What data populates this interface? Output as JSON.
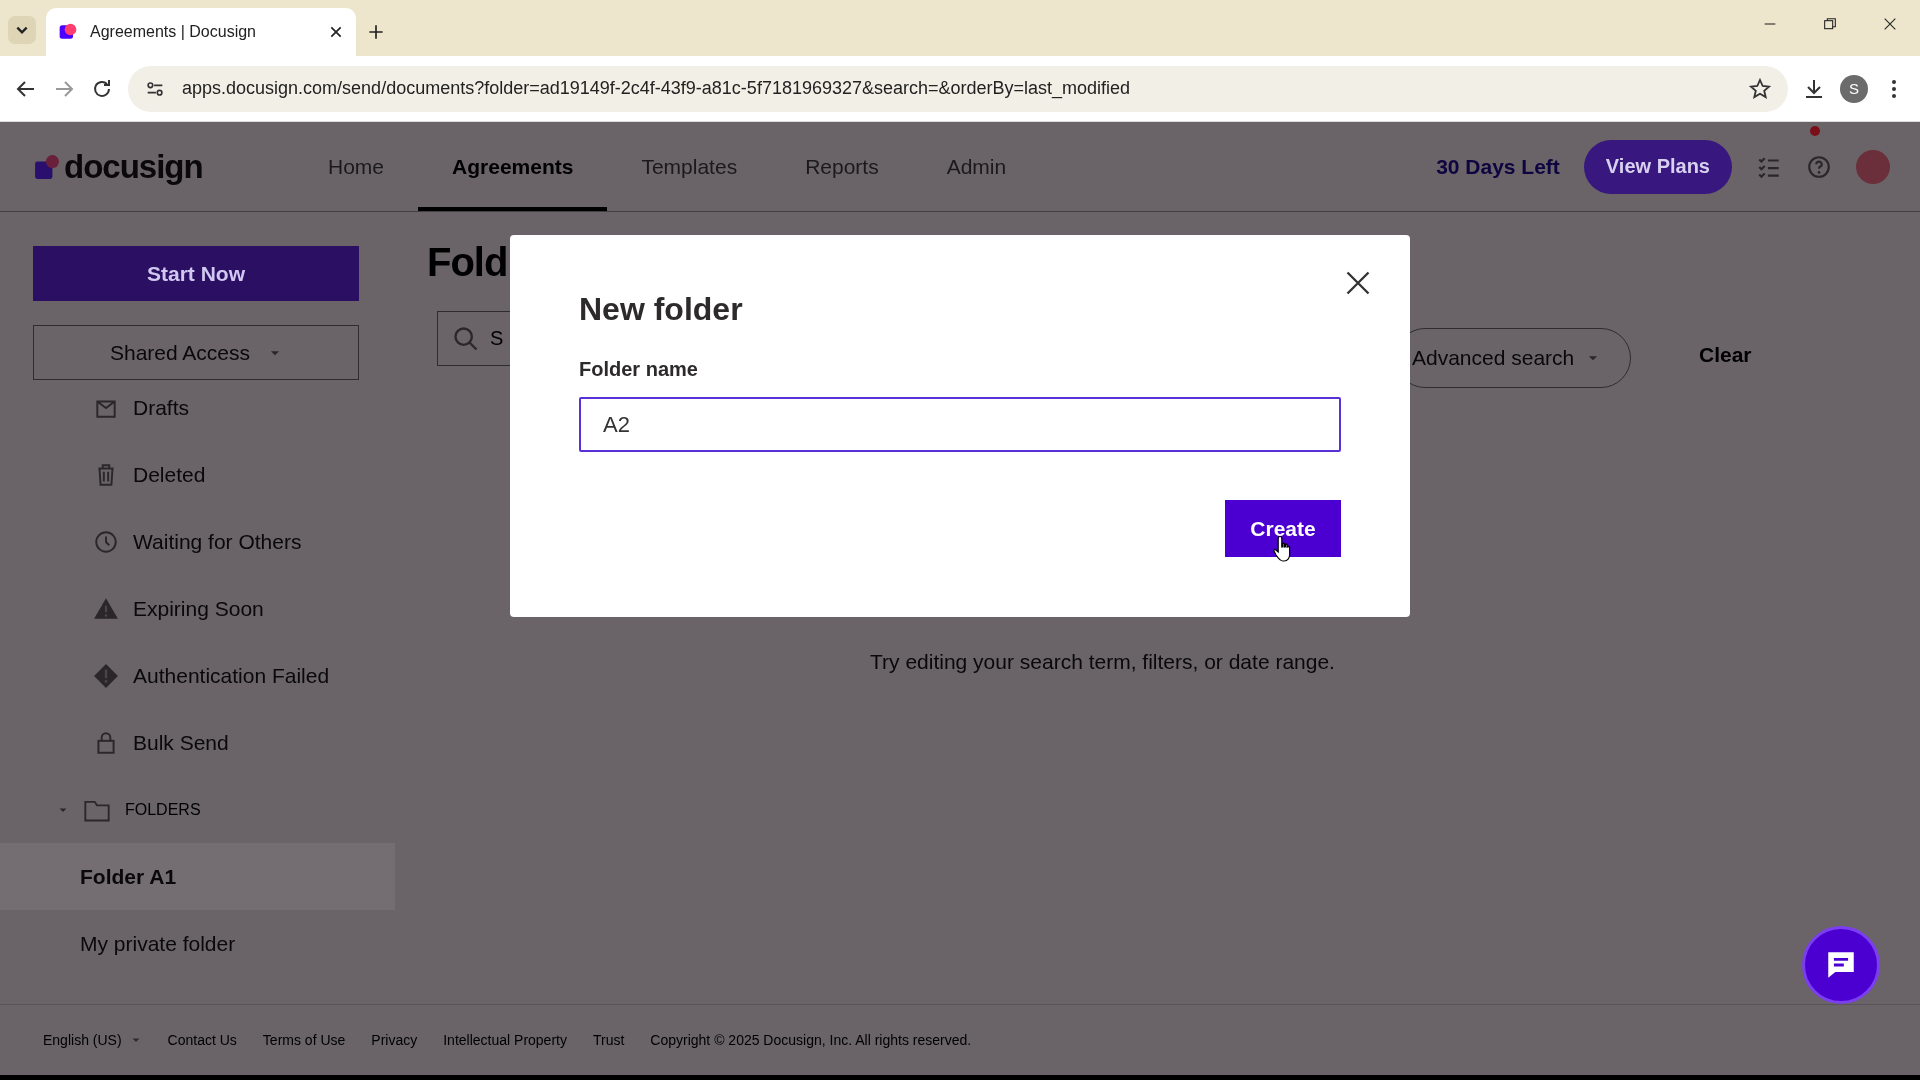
{
  "browser": {
    "tab_title": "Agreements | Docusign",
    "url": "apps.docusign.com/send/documents?folder=ad19149f-2c4f-43f9-a81c-5f7181969327&search=&orderBy=last_modified",
    "profile_initial": "S"
  },
  "header": {
    "logo": "docusign",
    "nav": [
      {
        "label": "Home",
        "selected": false
      },
      {
        "label": "Agreements",
        "selected": true
      },
      {
        "label": "Templates",
        "selected": false
      },
      {
        "label": "Reports",
        "selected": false
      },
      {
        "label": "Admin",
        "selected": false
      }
    ],
    "trial": "30 Days Left",
    "plans_button": "View Plans",
    "notification": true
  },
  "sidebar": {
    "start_button": "Start Now",
    "shared_access": "Shared Access",
    "items": [
      {
        "label": "Drafts"
      },
      {
        "label": "Deleted"
      },
      {
        "label": "Waiting for Others"
      },
      {
        "label": "Expiring Soon"
      },
      {
        "label": "Authentication Failed"
      },
      {
        "label": "Bulk Send"
      }
    ],
    "folders": {
      "label": "FOLDERS",
      "expanded": true,
      "children": [
        {
          "label": "Folder A1",
          "selected": true
        },
        {
          "label": "My private folder",
          "selected": false
        }
      ]
    }
  },
  "main": {
    "heading": "Fold",
    "search_placeholder": "S",
    "advanced_search": "Advanced search",
    "clear": "Clear",
    "empty_message": "Try editing your search term, filters, or date range."
  },
  "dialog": {
    "title": "New folder",
    "field_label": "Folder name",
    "field_value": "A2",
    "create_button": "Create"
  },
  "footer": {
    "language": "English (US)",
    "links": [
      "Contact Us",
      "Terms of Use",
      "Privacy",
      "Intellectual Property",
      "Trust"
    ],
    "copyright": "Copyright © 2025 Docusign, Inc. All rights reserved."
  }
}
